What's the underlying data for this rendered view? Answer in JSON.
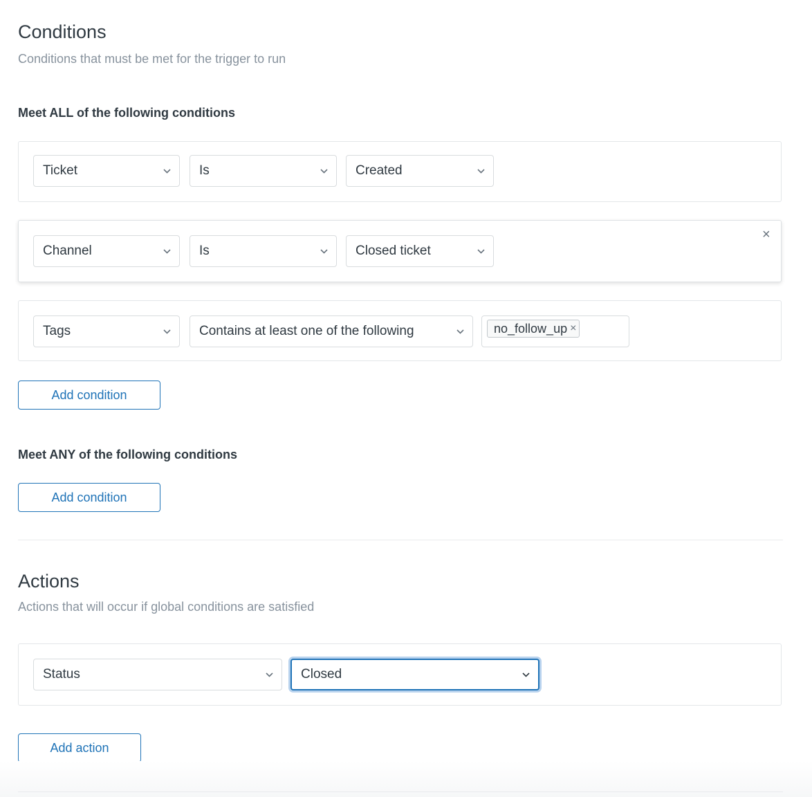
{
  "conditions": {
    "title": "Conditions",
    "subtitle": "Conditions that must be met for the trigger to run",
    "all": {
      "heading": "Meet ALL of the following conditions",
      "rows": [
        {
          "field": "Ticket",
          "operator": "Is",
          "value": "Created"
        },
        {
          "field": "Channel",
          "operator": "Is",
          "value": "Closed ticket",
          "remove": "×"
        },
        {
          "field": "Tags",
          "operator": "Contains at least one of the following",
          "tag": "no_follow_up",
          "tag_remove": "×"
        }
      ],
      "add_label": "Add condition"
    },
    "any": {
      "heading": "Meet ANY of the following conditions",
      "add_label": "Add condition"
    }
  },
  "actions": {
    "title": "Actions",
    "subtitle": "Actions that will occur if global conditions are satisfied",
    "rows": [
      {
        "field": "Status",
        "value": "Closed"
      }
    ],
    "add_label": "Add action"
  },
  "icons": {
    "dropdown": "chevron-down-icon",
    "remove": "close-icon"
  },
  "colors": {
    "accent": "#1f73b7",
    "focus_ring": "#b9d3ee",
    "text": "#2f3941",
    "muted": "#87929d",
    "border": "#d8dcde"
  }
}
